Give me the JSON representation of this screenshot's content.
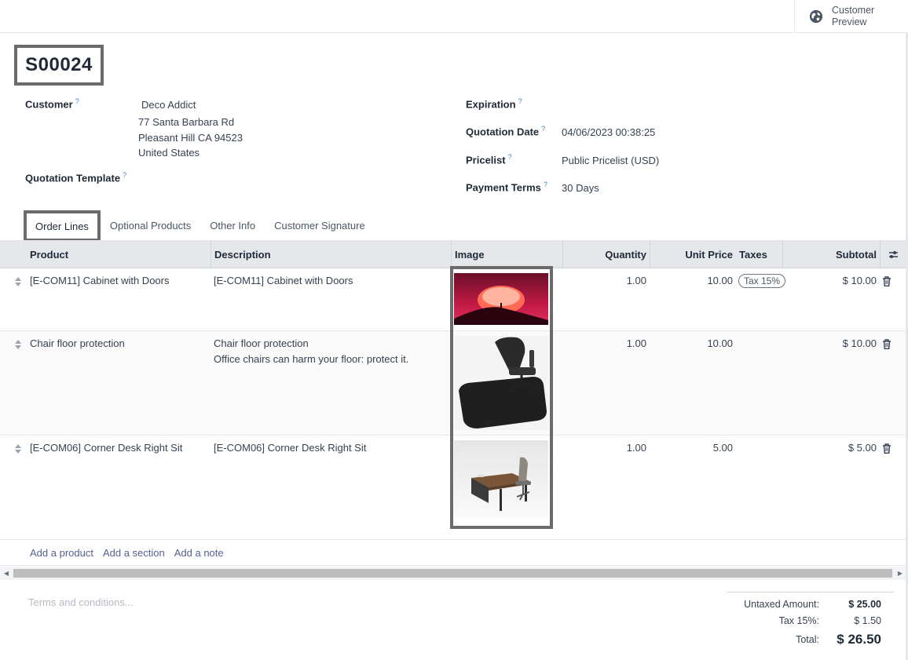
{
  "header": {
    "customer_preview_label": "Customer Preview",
    "order_name": "S00024"
  },
  "form": {
    "customer_label": "Customer",
    "customer_name": "Deco Addict",
    "customer_address": [
      "77 Santa Barbara Rd",
      "Pleasant Hill CA 94523",
      "United States"
    ],
    "quotation_template_label": "Quotation Template",
    "expiration_label": "Expiration",
    "quotation_date_label": "Quotation Date",
    "quotation_date_value": "04/06/2023 00:38:25",
    "pricelist_label": "Pricelist",
    "pricelist_value": "Public Pricelist (USD)",
    "payment_terms_label": "Payment Terms",
    "payment_terms_value": "30 Days",
    "help_mark": "?"
  },
  "tabs": [
    "Order Lines",
    "Optional Products",
    "Other Info",
    "Customer Signature"
  ],
  "table": {
    "columns": {
      "product": "Product",
      "description": "Description",
      "image": "Image",
      "quantity": "Quantity",
      "unit_price": "Unit Price",
      "taxes": "Taxes",
      "subtotal": "Subtotal"
    },
    "rows": [
      {
        "product": "[E-COM11] Cabinet with Doors",
        "description": "[E-COM11] Cabinet with Doors",
        "description_extra": "",
        "image_icon": "sunset-photo",
        "quantity": "1.00",
        "unit_price": "10.00",
        "tax": "Tax 15%",
        "subtotal": "$ 10.00"
      },
      {
        "product": "Chair floor protection",
        "description": "Chair floor protection",
        "description_extra": "Office chairs can harm your floor: protect it.",
        "image_icon": "chair-mat-photo",
        "quantity": "1.00",
        "unit_price": "10.00",
        "tax": "",
        "subtotal": "$ 10.00"
      },
      {
        "product": "[E-COM06] Corner Desk Right Sit",
        "description": "[E-COM06] Corner Desk Right Sit",
        "description_extra": "",
        "image_icon": "desk-photo",
        "quantity": "1.00",
        "unit_price": "5.00",
        "tax": "",
        "subtotal": "$ 5.00"
      }
    ],
    "add_links": [
      "Add a product",
      "Add a section",
      "Add a note"
    ]
  },
  "footer": {
    "terms_placeholder": "Terms and conditions...",
    "untaxed_label": "Untaxed Amount:",
    "untaxed_value": "$ 25.00",
    "tax_label": "Tax 15%:",
    "tax_value": "$ 1.50",
    "total_label": "Total:",
    "total_value": "$ 26.50"
  },
  "colors": {
    "highlight_border": "#6b6b6b",
    "link": "#56618f",
    "header_bg": "#e5e7eb"
  }
}
